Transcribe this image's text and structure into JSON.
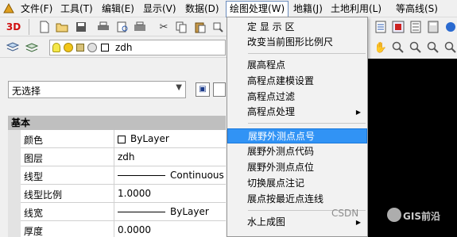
{
  "menubar": {
    "items": [
      "文件(F)",
      "工具(T)",
      "编辑(E)",
      "显示(V)",
      "数据(D)",
      "绘图处理(W)",
      "地籍(J)",
      "土地利用(L)",
      "等高线(S)"
    ]
  },
  "toolbar": {
    "three_d_label": "3D",
    "layer_name": "zdh"
  },
  "panel": {
    "selection_value": "无选择",
    "section_title": "基本",
    "properties": [
      {
        "label": "颜色",
        "value": "ByLayer"
      },
      {
        "label": "图层",
        "value": "zdh"
      },
      {
        "label": "线型",
        "value": "Continuous"
      },
      {
        "label": "线型比例",
        "value": "1.0000"
      },
      {
        "label": "线宽",
        "value": "ByLayer"
      },
      {
        "label": "厚度",
        "value": "0.0000"
      }
    ]
  },
  "dropdown": {
    "items": [
      {
        "label": "定 显 示 区"
      },
      {
        "label": "改变当前图形比例尺"
      },
      {
        "label": "展高程点"
      },
      {
        "label": "高程点建模设置"
      },
      {
        "label": "高程点过滤"
      },
      {
        "label": "高程点处理"
      },
      {
        "label": "展野外测点点号"
      },
      {
        "label": "展野外测点代码"
      },
      {
        "label": "展野外测点点位"
      },
      {
        "label": "切换展点注记"
      },
      {
        "label": "展点按最近点连线"
      },
      {
        "label": "水上成图"
      }
    ]
  },
  "watermark": {
    "csdn": "CSDN",
    "brand": "GIS前沿"
  },
  "colors": {
    "highlight": "#3193f5",
    "canvas": "#000000",
    "three_d": "#d01010"
  }
}
